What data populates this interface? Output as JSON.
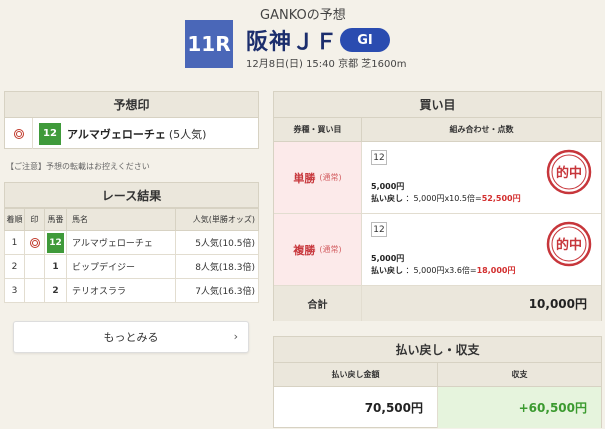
{
  "header": {
    "prediction_title": "GANKOの予想",
    "race_number": "11R",
    "race_name": "阪神ＪＦ",
    "grade": "GI",
    "race_info": "12月8日(日) 15:40 京都 芝1600m"
  },
  "prediction": {
    "heading": "予想印",
    "mark": "double-circle",
    "horse_number": "12",
    "horse_name": "アルマヴェローチェ",
    "popularity": "(5人気)"
  },
  "notice": "【ご注意】予想の転載はお控えください",
  "result": {
    "heading": "レース結果",
    "columns": [
      "着順",
      "印",
      "馬番",
      "馬名",
      "人気(単勝オッズ)"
    ],
    "rows": [
      {
        "rank": "1",
        "mark": "double-circle",
        "number": "12",
        "name": "アルマヴェローチェ",
        "popularity": "5人気(10.5倍)"
      },
      {
        "rank": "2",
        "mark": "",
        "number": "1",
        "name": "ビップデイジー",
        "popularity": "8人気(18.3倍)"
      },
      {
        "rank": "3",
        "mark": "",
        "number": "2",
        "name": "テリオスララ",
        "popularity": "7人気(16.3倍)"
      }
    ],
    "more_label": "もっとみる"
  },
  "bets": {
    "heading": "買い目",
    "col_type": "券種・買い目",
    "col_combo": "組み合わせ・点数",
    "rows": [
      {
        "type": "単勝",
        "note": "(通常)",
        "combo": "12",
        "amount": "5,000円",
        "payout_label": "払い戻し",
        "payout_formula": "：5,000円x10.5倍=",
        "payout_value": "52,500円",
        "stamp": "的中"
      },
      {
        "type": "複勝",
        "note": "(通常)",
        "combo": "12",
        "amount": "5,000円",
        "payout_label": "払い戻し",
        "payout_formula": "：5,000円x3.6倍=",
        "payout_value": "18,000円",
        "stamp": "的中"
      }
    ],
    "total_label": "合計",
    "total_value": "10,000円"
  },
  "payout": {
    "heading": "払い戻し・収支",
    "col_payback": "払い戻し金額",
    "col_balance": "収支",
    "payback_value": "70,500円",
    "balance_value": "+60,500円"
  },
  "colors": {
    "race_badge": "#4a67b8",
    "grade_badge": "#2a4cb0",
    "horse_number": "#3f9a3a",
    "hit_red": "#c7363b",
    "balance_green": "#3b9a2f"
  }
}
